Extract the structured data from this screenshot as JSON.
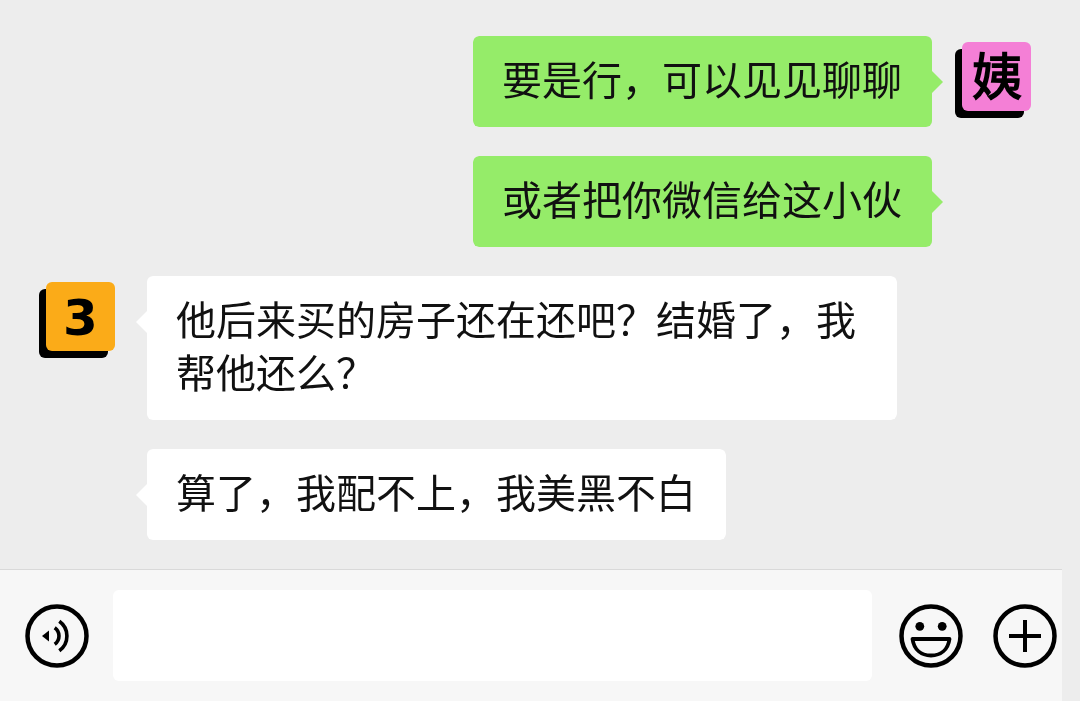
{
  "messages": [
    {
      "kind": "sent",
      "text": "要是行，可以见见聊聊",
      "avatar": {
        "text": "姨",
        "color": "#f47fd6"
      }
    },
    {
      "kind": "sent",
      "text": "或者把你微信给这小伙"
    },
    {
      "kind": "received",
      "text": "他后来买的房子还在还吧？结婚了，我帮他还么？",
      "avatar": {
        "text": "3",
        "color": "#fbab18"
      }
    },
    {
      "kind": "received",
      "text": "算了，我配不上，我美黑不白"
    }
  ]
}
